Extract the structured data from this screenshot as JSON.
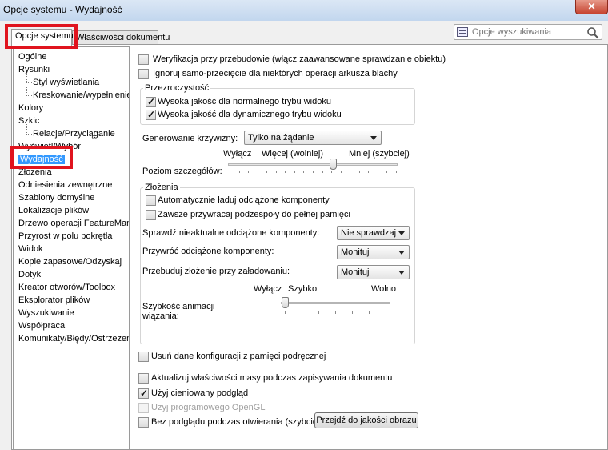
{
  "window": {
    "title": "Opcje systemu - Wydajność",
    "close_label": "✕"
  },
  "tabs": [
    {
      "label": "Opcje systemu"
    },
    {
      "label": "Właściwości dokumentu"
    }
  ],
  "search": {
    "placeholder": "Opcje wyszukiwania"
  },
  "tree": {
    "items": [
      {
        "label": "Ogólne"
      },
      {
        "label": "Rysunki"
      },
      {
        "label": "Styl wyświetlania"
      },
      {
        "label": "Kreskowanie/wypełnienie"
      },
      {
        "label": "Kolory"
      },
      {
        "label": "Szkic"
      },
      {
        "label": "Relacje/Przyciąganie"
      },
      {
        "label": "Wyświetl/Wybór"
      },
      {
        "label": "Wydajność"
      },
      {
        "label": "Złożenia"
      },
      {
        "label": "Odniesienia zewnętrzne"
      },
      {
        "label": "Szablony domyślne"
      },
      {
        "label": "Lokalizacje plików"
      },
      {
        "label": "Drzewo operacji FeatureManager"
      },
      {
        "label": "Przyrost w polu pokrętła"
      },
      {
        "label": "Widok"
      },
      {
        "label": "Kopie zapasowe/Odzyskaj"
      },
      {
        "label": "Dotyk"
      },
      {
        "label": "Kreator otworów/Toolbox"
      },
      {
        "label": "Eksplorator plików"
      },
      {
        "label": "Wyszukiwanie"
      },
      {
        "label": "Współpraca"
      },
      {
        "label": "Komunikaty/Błędy/Ostrzeżenia"
      }
    ]
  },
  "options": {
    "verify_rebuild": {
      "label": "Weryfikacja przy przebudowie (włącz zaawansowane sprawdzanie obiektu)",
      "checked": false
    },
    "ignore_self_intersection": {
      "label": "Ignoruj samo-przecięcie dla niektórych operacji arkusza blachy",
      "checked": false
    },
    "transparency_group": "Przezroczystość",
    "hq_normal": {
      "label": "Wysoka jakość dla normalnego trybu widoku",
      "checked": true
    },
    "hq_dynamic": {
      "label": "Wysoka jakość dla dynamicznego trybu widoku",
      "checked": true
    },
    "curvature_label": "Generowanie krzywizny:",
    "curvature_value": "Tylko na żądanie",
    "detail_label": "Poziom szczegółów:",
    "detail_off": "Wyłącz",
    "detail_more": "Więcej (wolniej)",
    "detail_less": "Mniej (szybciej)",
    "detail_level": 0.62,
    "assemblies_group": "Złożenia",
    "auto_load_light": {
      "label": "Automatycznie ładuj odciążone komponenty",
      "checked": false
    },
    "always_resolve": {
      "label": "Zawsze przywracaj podzespoły do pełnej pamięci",
      "checked": false
    },
    "check_outdated_label": "Sprawdź nieaktualne odciążone komponenty:",
    "check_outdated_value": "Nie sprawdzaj",
    "resolve_light_label": "Przywróć odciążone komponenty:",
    "resolve_light_value": "Monituj",
    "rebuild_on_load_label": "Przebuduj złożenie przy załadowaniu:",
    "rebuild_on_load_value": "Monituj",
    "anim_off": "Wyłącz",
    "anim_fast": "Szybko",
    "anim_slow": "Wolno",
    "anim_label_1": "Szybkość animacji",
    "anim_label_2": "wiązania:",
    "anim_level": 0.0,
    "purge_cache": {
      "label": "Usuń dane konfiguracji z pamięci podręcznej",
      "checked": false
    },
    "update_mass": {
      "label": "Aktualizuj właściwości masy podczas zapisywania dokumentu",
      "checked": false
    },
    "shaded_preview": {
      "label": "Użyj cieniowany podgląd",
      "checked": true
    },
    "software_opengl": {
      "label": "Użyj programowego OpenGL",
      "checked": false
    },
    "no_preview_open": {
      "label": "Bez podglądu podczas otwierania (szybciej)",
      "checked": false
    },
    "image_quality_button": "Przejdź do jakości obrazu"
  }
}
